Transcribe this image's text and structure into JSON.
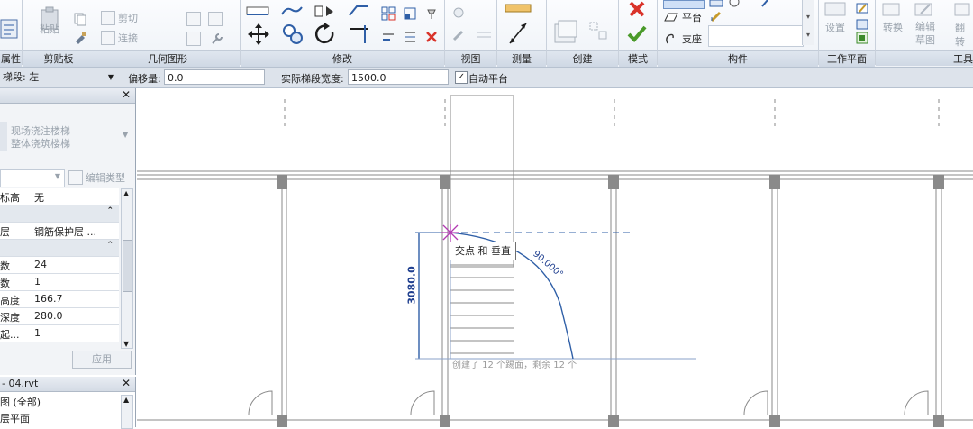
{
  "ribbon": {
    "panels": [
      {
        "name": "properties",
        "label": "属性"
      },
      {
        "name": "clipboard",
        "label": "剪贴板"
      },
      {
        "name": "geometry",
        "label": "几何图形"
      },
      {
        "name": "modify",
        "label": "修改"
      },
      {
        "name": "view",
        "label": "视图"
      },
      {
        "name": "measure",
        "label": "测量"
      },
      {
        "name": "create",
        "label": "创建"
      },
      {
        "name": "mode",
        "label": "模式"
      },
      {
        "name": "component",
        "label": "构件"
      },
      {
        "name": "workplane",
        "label": "工作平面"
      },
      {
        "name": "tools",
        "label": "工具"
      }
    ],
    "clipboard": {
      "paste": "粘贴"
    },
    "geometry": {
      "cut": "剪切",
      "join": "连接"
    },
    "component": {
      "landing": "平台",
      "support": "支座"
    },
    "workplane": {
      "set": "设置"
    },
    "tools": {
      "convert": "转换",
      "edit_sketch": "编辑",
      "edit_sketch_2": "草图",
      "flip": "翻转"
    }
  },
  "options_bar": {
    "location_label": "梯段: 左",
    "offset_label": "偏移量:",
    "offset_value": "0.0",
    "width_label": "实际梯段宽度:",
    "width_value": "1500.0",
    "auto_landing_label": "自动平台",
    "auto_landing_checked": true
  },
  "properties": {
    "type_line1": "现场浇注楼梯",
    "type_line2": "整体浇筑楼梯",
    "edit_type": "编辑类型",
    "rows": [
      {
        "k": "标高",
        "v": "无",
        "group": false
      },
      {
        "k": "",
        "v": "",
        "group": true
      },
      {
        "k": "层",
        "v": "钢筋保护层 ...",
        "group": false
      },
      {
        "k": "",
        "v": "",
        "group": true
      },
      {
        "k": "数",
        "v": "24",
        "group": false
      },
      {
        "k": "数",
        "v": "1",
        "group": false
      },
      {
        "k": "高度",
        "v": "166.7",
        "group": false
      },
      {
        "k": "深度",
        "v": "280.0",
        "group": false
      },
      {
        "k": "起...",
        "v": "1",
        "group": false
      }
    ],
    "apply": "应用"
  },
  "browser": {
    "title": "- 04.rvt",
    "items": [
      "图 (全部)",
      "层平面"
    ]
  },
  "canvas": {
    "tooltip": "交点 和 垂直",
    "dim_vertical": "3080.0",
    "angle": "90.000°",
    "status": "创建了 12 个踢面，剩余 12 个"
  },
  "colors": {
    "accent_blue": "#2f5fa7",
    "dim_blue": "#1f3f8f",
    "snap_magenta": "#b33ab3",
    "cancel_red": "#d9332a",
    "ok_green": "#4a9a2a"
  }
}
